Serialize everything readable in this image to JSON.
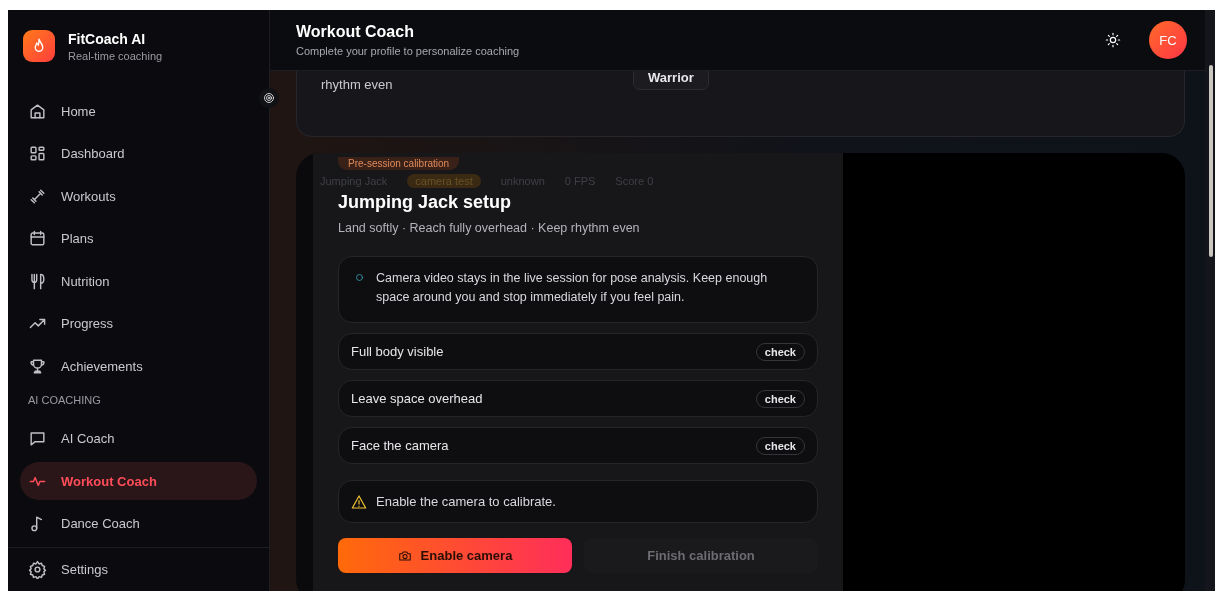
{
  "app": {
    "name": "FitCoach AI",
    "tagline": "Real-time coaching"
  },
  "sidebar": {
    "groups": [
      {
        "items": [
          {
            "label": "Home",
            "selected": false
          },
          {
            "label": "Dashboard",
            "selected": false
          },
          {
            "label": "Workouts",
            "selected": false
          },
          {
            "label": "Plans",
            "selected": false
          },
          {
            "label": "Nutrition",
            "selected": false
          },
          {
            "label": "Progress",
            "selected": false
          },
          {
            "label": "Achievements",
            "selected": false
          }
        ]
      },
      {
        "heading": "AI COACHING",
        "items": [
          {
            "label": "AI Coach",
            "selected": false
          },
          {
            "label": "Workout Coach",
            "selected": true
          },
          {
            "label": "Dance Coach",
            "selected": false
          }
        ]
      },
      {
        "items": [
          {
            "label": "Settings",
            "selected": false
          }
        ]
      }
    ]
  },
  "header": {
    "title": "Workout Coach",
    "subtitle": "Complete your profile to personalize coaching",
    "avatar": "FC"
  },
  "previous_card": {
    "text": "rhythm even",
    "chip": "Warrior"
  },
  "session": {
    "badge": "Pre-session calibration",
    "status": [
      {
        "text": "Jumping Jack",
        "kind": "plain"
      },
      {
        "text": "camera test",
        "kind": "pill"
      },
      {
        "text": "unknown",
        "kind": "plain"
      },
      {
        "text": "0 FPS",
        "kind": "plain"
      },
      {
        "text": "Score 0",
        "kind": "plain"
      }
    ],
    "title": "Jumping Jack setup",
    "subtitle": "Land softly · Reach fully overhead · Keep rhythm even",
    "notice": "Camera video stays in the live session for pose analysis. Keep enough space around you and stop immediately if you feel pain.",
    "checks": [
      {
        "label": "Full body visible",
        "status": "check"
      },
      {
        "label": "Leave space overhead",
        "status": "check"
      },
      {
        "label": "Face the camera",
        "status": "check"
      }
    ],
    "warning": "Enable the camera to calibrate.",
    "buttons": [
      {
        "label": "Enable camera",
        "kind": "primary",
        "disabled": false
      },
      {
        "label": "Finish calibration",
        "kind": "secondary",
        "disabled": true
      }
    ]
  }
}
